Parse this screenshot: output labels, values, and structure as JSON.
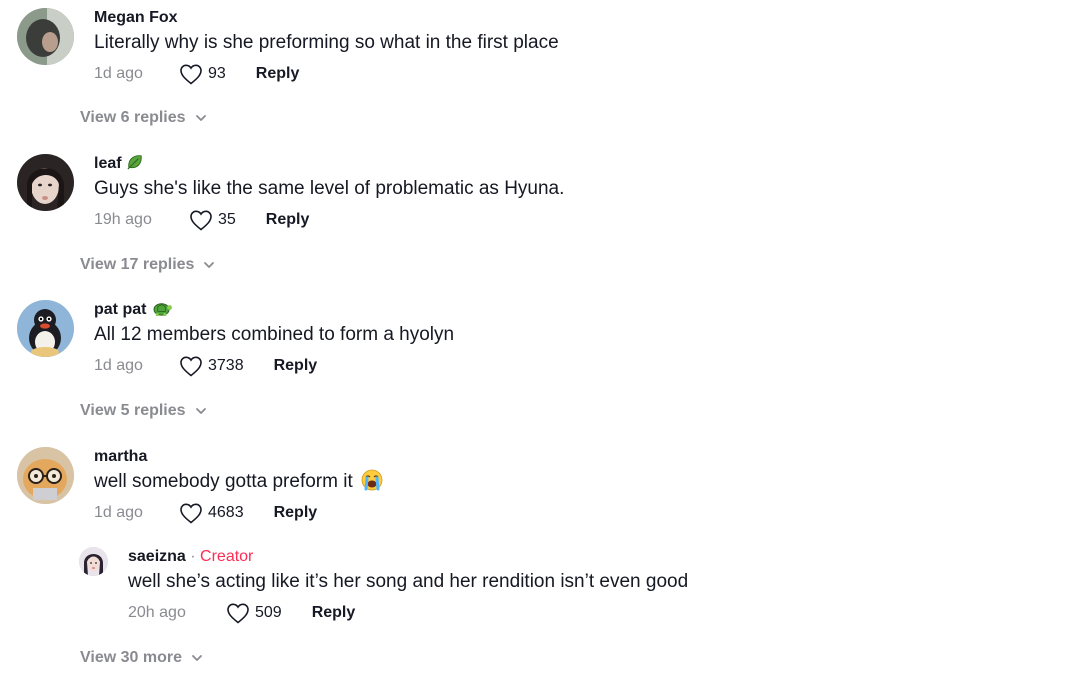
{
  "comments": [
    {
      "username": "Megan Fox",
      "text": "Literally why is she preforming so what in the first place",
      "time": "1d ago",
      "likes": "93",
      "reply_label": "Reply",
      "view_replies": "View 6 replies"
    },
    {
      "username": "leaf",
      "username_emoji": "leaf-emoji",
      "text": "Guys she's like the same level of problematic as Hyuna.",
      "time": "19h ago",
      "likes": "35",
      "reply_label": "Reply",
      "view_replies": "View 17 replies"
    },
    {
      "username": "pat pat",
      "username_emoji": "turtle-emoji",
      "text": "All 12 members combined to form a hyolyn",
      "time": "1d ago",
      "likes": "3738",
      "reply_label": "Reply",
      "view_replies": "View 5 replies"
    },
    {
      "username": "martha",
      "text": "well somebody gotta preform it",
      "text_emoji": "loudly-crying-face-emoji",
      "time": "1d ago",
      "likes": "4683",
      "reply_label": "Reply",
      "replies": [
        {
          "username": "saeizna",
          "separator": " · ",
          "badge": "Creator",
          "text": "well she’s acting like it’s her song and her rendition isn’t even good",
          "time": "20h ago",
          "likes": "509",
          "reply_label": "Reply"
        }
      ],
      "view_replies": "View 30 more"
    }
  ],
  "colors": {
    "muted": "#8a8b91",
    "text": "#161823",
    "creator": "#fe2c55"
  }
}
